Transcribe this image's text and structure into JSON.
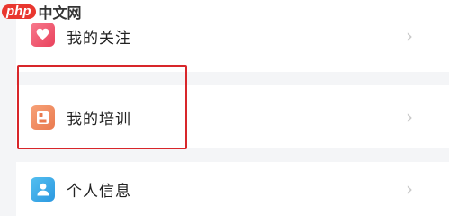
{
  "watermark": {
    "logo": "php",
    "text": "中文网"
  },
  "menu": {
    "items": [
      {
        "label": "我的关注",
        "icon": "heart-icon",
        "chevron": "›"
      },
      {
        "label": "我的培训",
        "icon": "document-icon",
        "chevron": "›"
      },
      {
        "label": "个人信息",
        "icon": "user-icon",
        "chevron": "›"
      }
    ]
  },
  "colors": {
    "highlight": "#d8262a",
    "heart_icon_bg": "#e9415c",
    "document_icon_bg": "#ea7a4f",
    "user_icon_bg": "#2b98e0",
    "page_bg": "#f4f5f7"
  }
}
